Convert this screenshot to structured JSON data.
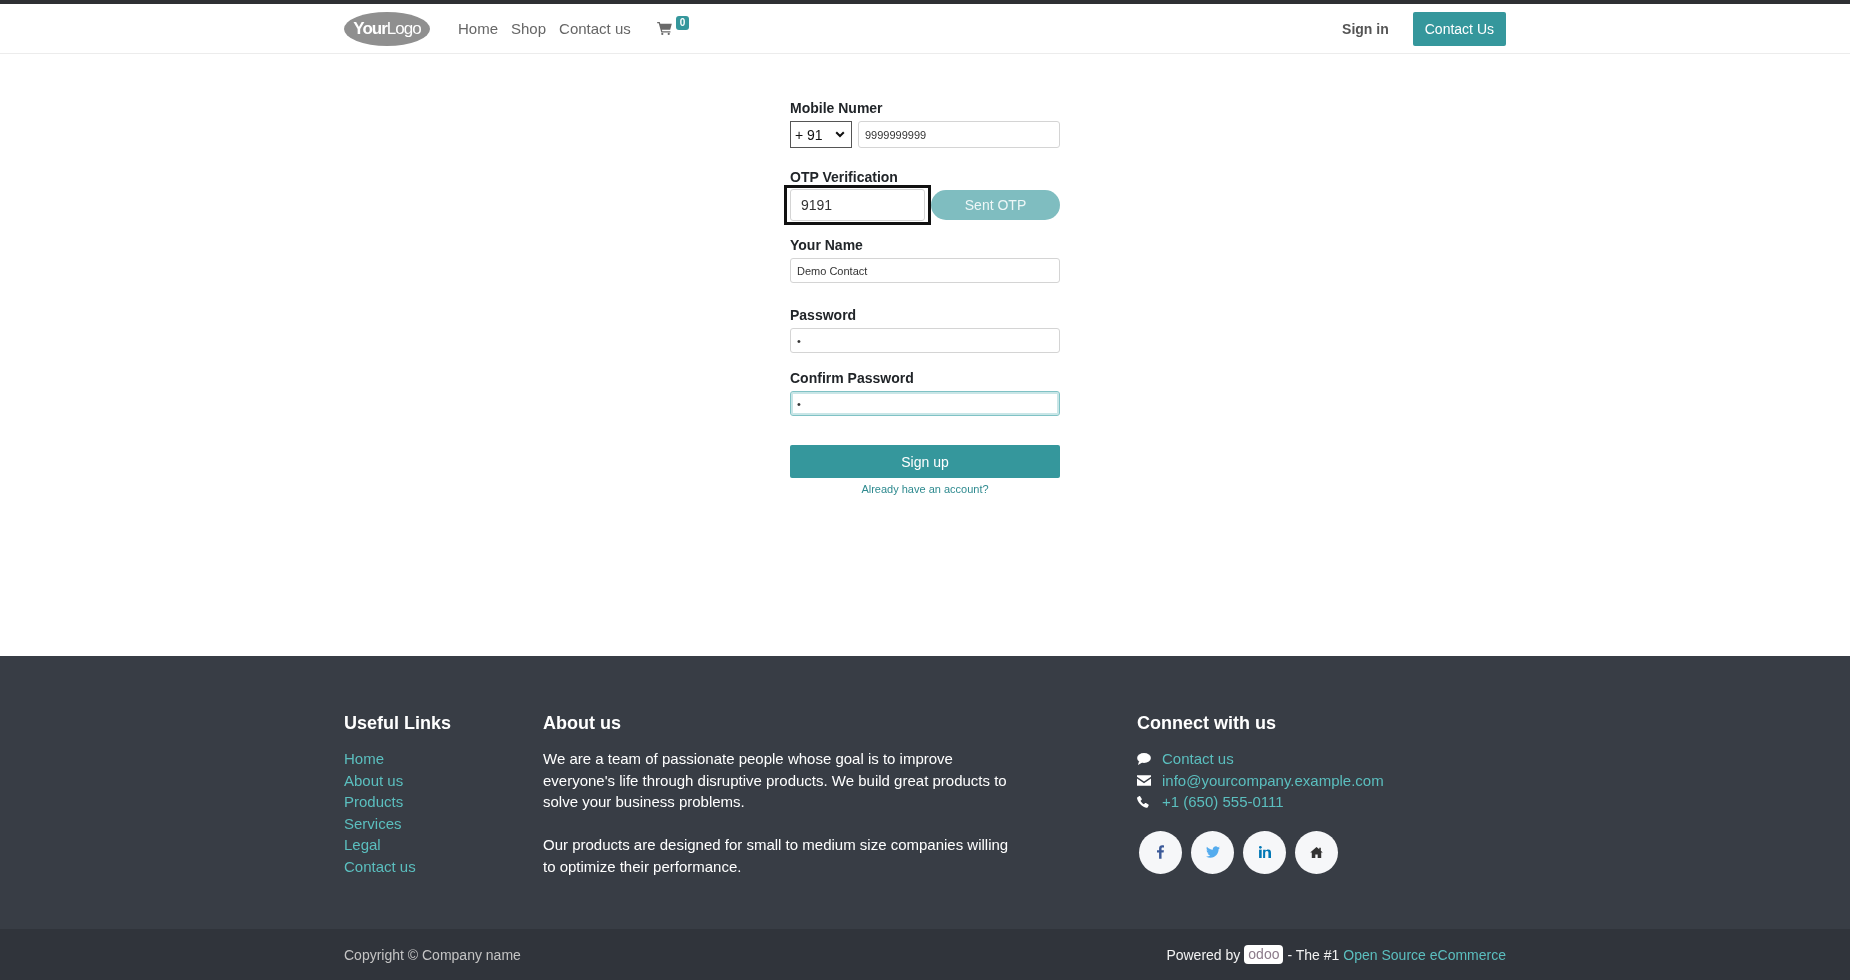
{
  "header": {
    "logo": "**Your**Logo",
    "nav": [
      "Home",
      "Shop",
      "Contact us"
    ],
    "cart_count": "0",
    "sign_in": "Sign in",
    "contact_button": "Contact Us"
  },
  "signup_form": {
    "mobile": {
      "label": "Mobile Numer",
      "country_code": "+ 91",
      "value": "9999999999"
    },
    "otp": {
      "label": "OTP Verification",
      "value": "9191",
      "highlighted": true,
      "send_button": {
        "label": "Sent OTP",
        "disabled": true
      }
    },
    "fields": [
      {
        "label": "Your Name",
        "value": "Demo Contact",
        "focused": false
      },
      {
        "label": "Password",
        "value": "•",
        "focused": false
      },
      {
        "label": "Confirm Password",
        "value": "•",
        "focused": true
      }
    ],
    "submit_button": "Sign up",
    "login_link": "Already have an account?"
  },
  "footer": {
    "useful_links": {
      "title": "Useful Links",
      "links": [
        "Home",
        "About us",
        "Products",
        "Services",
        "Legal",
        "Contact us"
      ]
    },
    "about": {
      "title": "About us",
      "paragraphs": [
        "We are a team of passionate people whose goal is to improve everyone's life through disruptive products. We build great products to solve your business problems.",
        "Our products are designed for small to medium size companies willing to optimize their performance."
      ]
    },
    "connect": {
      "title": "Connect with us",
      "items": [
        {
          "kind": "chat",
          "text": "Contact us"
        },
        {
          "kind": "email",
          "text": "info@yourcompany.example.com"
        },
        {
          "kind": "phone",
          "text": "+1 (650) 555-0111"
        }
      ],
      "social": [
        {
          "kind": "facebook"
        },
        {
          "kind": "twitter"
        },
        {
          "kind": "linkedin"
        },
        {
          "kind": "home"
        }
      ]
    }
  },
  "bottom_bar": {
    "copyright": "Copyright © Company name",
    "powered_by": "Powered by",
    "brand_logo": "odoo",
    "tagline": "- The #1",
    "link": "Open Source eCommerce"
  }
}
